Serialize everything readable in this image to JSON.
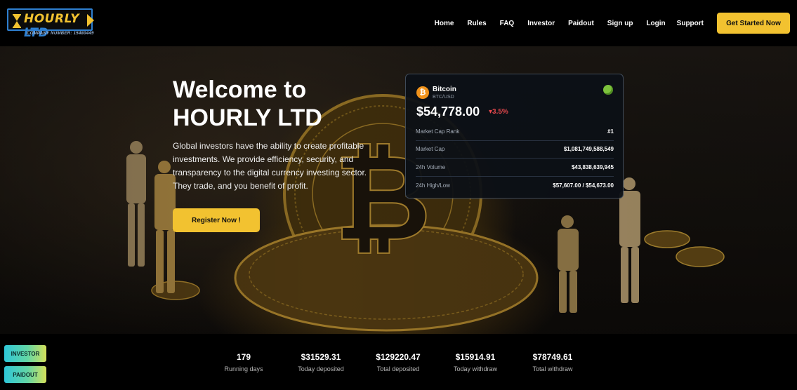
{
  "brand": {
    "name": "HOURLY",
    "suffix": "LTD",
    "company_number": "COMPANY NUMBER: 15480449"
  },
  "nav": {
    "items": [
      "Home",
      "Rules",
      "FAQ",
      "Investor",
      "Paidout",
      "Sign up",
      "Login",
      "Support"
    ],
    "cta_label": "Get Started Now"
  },
  "hero": {
    "title_line1": "Welcome to",
    "title_line2": "HOURLY LTD",
    "description": "Global investors have the ability to create profitable investments. We provide efficiency, security, and transparency to the digital currency investing sector. They trade, and you benefit of profit.",
    "button_label": "Register Now !"
  },
  "crypto_card": {
    "icon": "bitcoin-icon",
    "icon_glyph": "₿",
    "name": "Bitcoin",
    "pair": "BTC/USD",
    "price": "$54,778.00",
    "change": "3.5%",
    "change_direction": "down",
    "rows": [
      {
        "label": "Market Cap Rank",
        "value": "#1"
      },
      {
        "label": "Market Cap",
        "value": "$1,081,749,588,549"
      },
      {
        "label": "24h Volume",
        "value": "$43,838,639,945"
      },
      {
        "label": "24h High/Low",
        "value": "$57,607.00 / $54,673.00"
      }
    ]
  },
  "stats": [
    {
      "value": "179",
      "label": "Running days"
    },
    {
      "value": "$31529.31",
      "label": "Today deposited"
    },
    {
      "value": "$129220.47",
      "label": "Total deposited"
    },
    {
      "value": "$15914.91",
      "label": "Today withdraw"
    },
    {
      "value": "$78749.61",
      "label": "Total withdraw"
    }
  ],
  "side_buttons": {
    "investor": "INVESTOR",
    "paidout": "PAIDOUT"
  },
  "colors": {
    "accent": "#f2c230",
    "brand_blue": "#2e7fd0",
    "negative": "#e5484d",
    "bitcoin": "#f0921b"
  }
}
